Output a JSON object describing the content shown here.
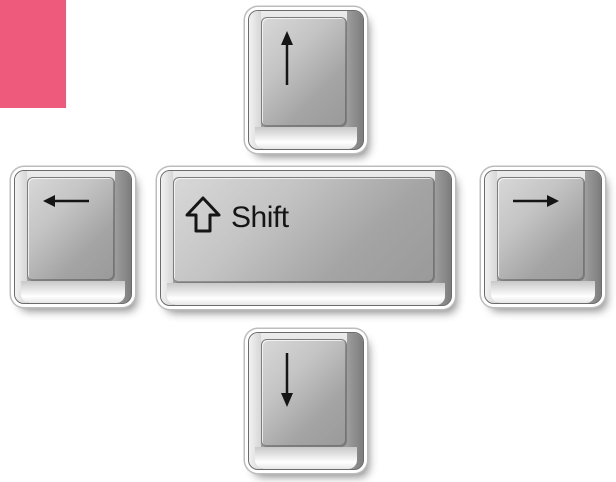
{
  "colors": {
    "pink_block": "#ee5a7b",
    "key_dark": "#6b6b6b",
    "glyph": "#151515"
  },
  "keys": {
    "up": {
      "icon": "arrow-up-icon"
    },
    "left": {
      "icon": "arrow-left-icon"
    },
    "shift": {
      "icon": "shift-arrow-icon",
      "label": "Shift"
    },
    "right": {
      "icon": "arrow-right-icon"
    },
    "down": {
      "icon": "arrow-down-icon"
    }
  }
}
